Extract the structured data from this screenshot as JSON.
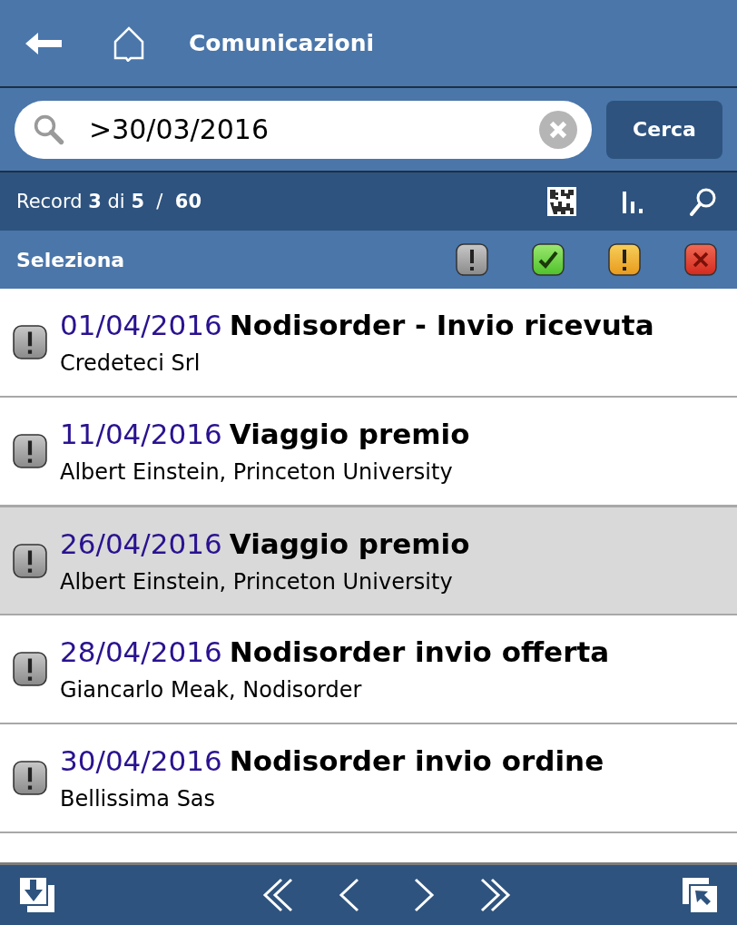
{
  "header": {
    "title": "Comunicazioni"
  },
  "search": {
    "value": ">30/03/2016",
    "button": "Cerca"
  },
  "record_bar": {
    "text": "Record **3** di **5**  /  **60**"
  },
  "filter_bar": {
    "label": "Seleziona",
    "filters": [
      {
        "kind": "neutral"
      },
      {
        "kind": "done"
      },
      {
        "kind": "warning"
      },
      {
        "kind": "error"
      }
    ]
  },
  "rows": [
    {
      "date": "01/04/2016",
      "title": "Nodisorder - Invio ricevuta",
      "subtitle": "Credeteci Srl",
      "kind": "neutral",
      "selected": false
    },
    {
      "date": "11/04/2016",
      "title": "Viaggio premio",
      "subtitle": "Albert Einstein, Princeton University",
      "kind": "neutral",
      "selected": false
    },
    {
      "date": "26/04/2016",
      "title": "Viaggio premio",
      "subtitle": "Albert Einstein, Princeton University",
      "kind": "neutral",
      "selected": true
    },
    {
      "date": "28/04/2016",
      "title": "Nodisorder invio offerta",
      "subtitle": "Giancarlo Meak, Nodisorder",
      "kind": "neutral",
      "selected": false
    },
    {
      "date": "30/04/2016",
      "title": "Nodisorder invio ordine",
      "subtitle": "Bellissima Sas",
      "kind": "neutral",
      "selected": false
    }
  ]
}
